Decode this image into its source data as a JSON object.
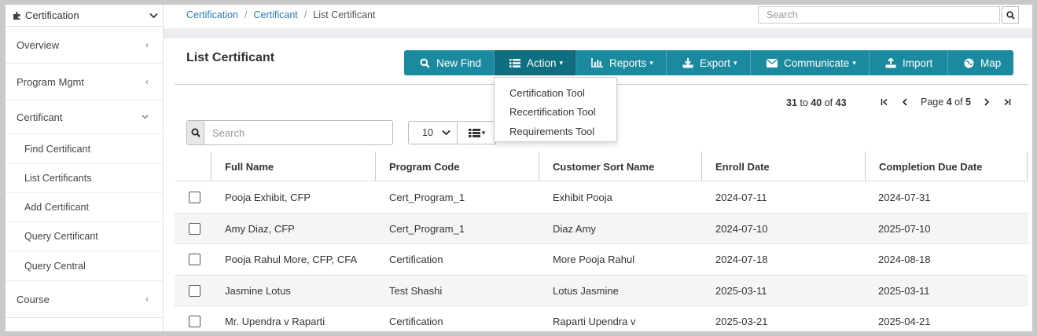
{
  "sidebar": {
    "header": "Certification",
    "items": [
      {
        "label": "Overview"
      },
      {
        "label": "Program Mgmt"
      },
      {
        "label": "Certificant"
      },
      {
        "label": "Course"
      }
    ],
    "sub_items": [
      {
        "label": "Find Certificant"
      },
      {
        "label": "List Certificants"
      },
      {
        "label": "Add Certificant"
      },
      {
        "label": "Query Certificant"
      },
      {
        "label": "Query Central"
      }
    ]
  },
  "breadcrumb": {
    "item1": "Certification",
    "item2": "Certificant",
    "item3": "List Certificant",
    "sep": "/"
  },
  "top_search": {
    "placeholder": "Search"
  },
  "page": {
    "title": "List Certificant"
  },
  "toolbar": {
    "new_find": "New Find",
    "action": "Action",
    "reports": "Reports",
    "export": "Export",
    "communicate": "Communicate",
    "import": "Import",
    "map": "Map"
  },
  "action_menu": {
    "items": [
      "Certification Tool",
      "Recertification Tool",
      "Requirements Tool"
    ]
  },
  "pagination": {
    "range_start": "31",
    "range_to": "to",
    "range_end": "40",
    "range_of": "of",
    "total": "43",
    "page_word": "Page",
    "current_page": "4",
    "of_word": "of",
    "total_pages": "5"
  },
  "grid_search": {
    "placeholder": "Search"
  },
  "page_size": {
    "value": "10"
  },
  "table": {
    "headers": [
      "Full Name",
      "Program Code",
      "Customer Sort Name",
      "Enroll Date",
      "Completion Due Date"
    ],
    "rows": [
      [
        "Pooja Exhibit, CFP",
        "Cert_Program_1",
        "Exhibit Pooja",
        "2024-07-11",
        "2024-07-31"
      ],
      [
        "Amy Diaz, CFP",
        "Cert_Program_1",
        "Diaz Amy",
        "2024-07-10",
        "2025-07-10"
      ],
      [
        "Pooja Rahul More, CFP, CFA",
        "Certification",
        "More Pooja Rahul",
        "2024-07-18",
        "2024-08-18"
      ],
      [
        "Jasmine Lotus",
        "Test Shashi",
        "Lotus Jasmine",
        "2025-03-11",
        "2025-03-11"
      ],
      [
        "Mr. Upendra v Raparti",
        "Certification",
        "Raparti Upendra v",
        "2025-03-21",
        "2025-04-21"
      ]
    ]
  },
  "colors": {
    "toolbar": "#1b8a9e",
    "toolbar_active": "#0f6f80",
    "link": "#2a7ab8"
  }
}
